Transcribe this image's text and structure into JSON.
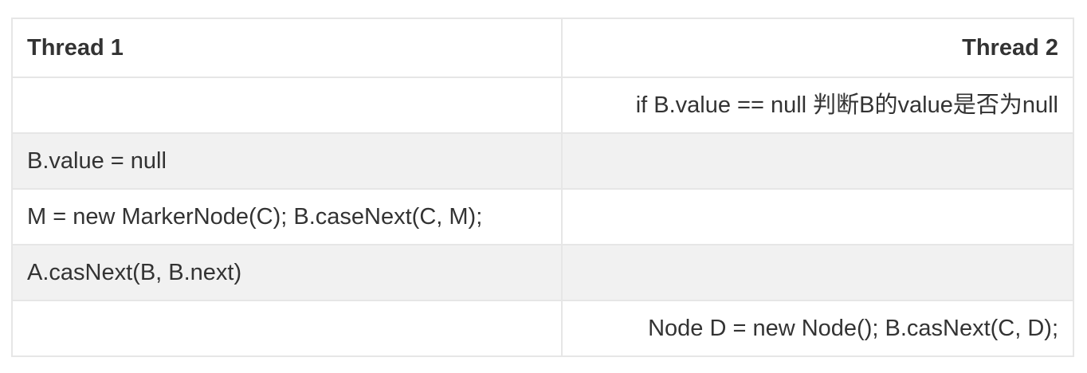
{
  "table": {
    "headers": [
      "Thread 1",
      "Thread 2"
    ],
    "rows": [
      [
        "",
        "if B.value == null 判断B的value是否为null"
      ],
      [
        "B.value = null",
        ""
      ],
      [
        "M = new MarkerNode(C); B.caseNext(C, M);",
        ""
      ],
      [
        "A.casNext(B, B.next)",
        ""
      ],
      [
        "",
        "Node D = new Node(); B.casNext(C, D);"
      ]
    ]
  }
}
